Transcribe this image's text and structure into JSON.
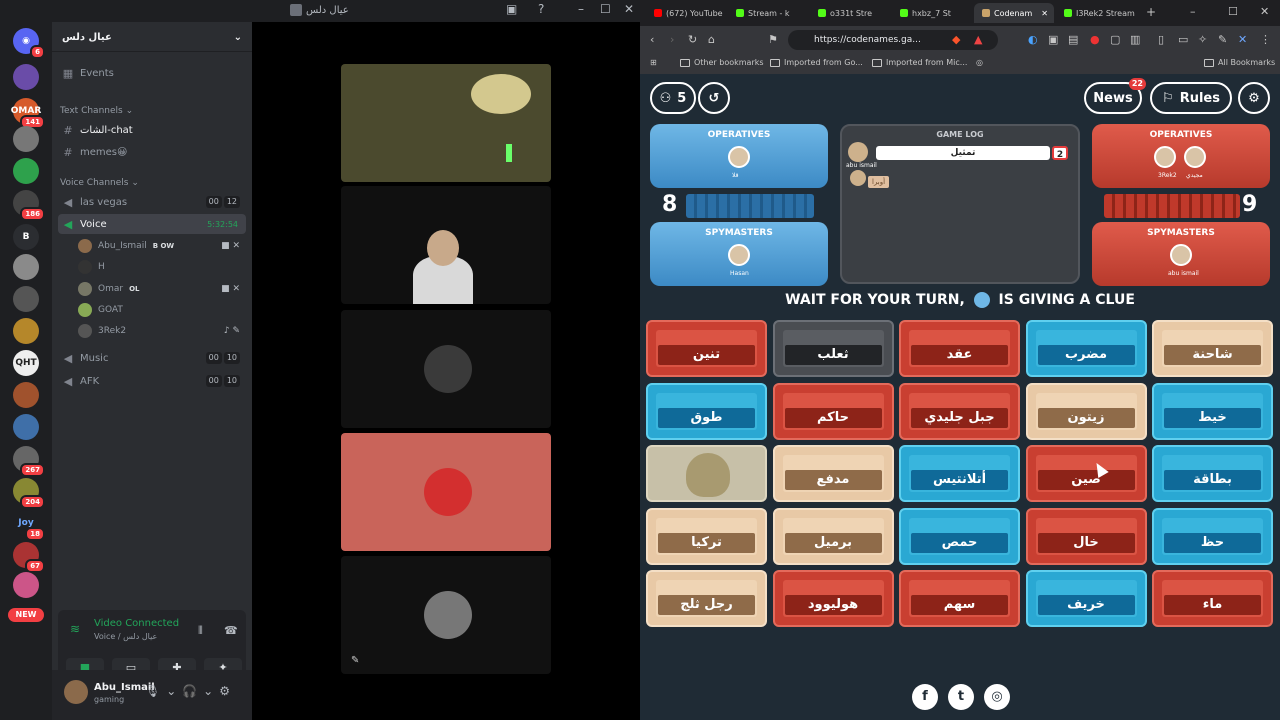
{
  "discord": {
    "window_title": "عيال دلس",
    "server_name": "عيال دلس",
    "events": "Events",
    "text_channels_label": "Text Channels",
    "text_channels": [
      "الشات-chat",
      "memes😀"
    ],
    "voice_channels_label": "Voice Channels",
    "voice_channels": [
      {
        "name": "las vegas",
        "a": "00",
        "b": "12"
      },
      {
        "name": "Voice",
        "timer": "5:32:54"
      },
      {
        "name": "Music",
        "a": "00",
        "b": "10"
      },
      {
        "name": "AFK",
        "a": "00",
        "b": "10"
      }
    ],
    "voice_users": [
      {
        "name": "Abu_Ismail",
        "tag": "B OW"
      },
      {
        "name": "H",
        "tag": ""
      },
      {
        "name": "Omar",
        "tag": "OL"
      },
      {
        "name": "GOAT",
        "tag": ""
      },
      {
        "name": "3Rek2",
        "tag": ""
      }
    ],
    "server_badges": [
      "6",
      "141",
      "186",
      "267",
      "204",
      "18",
      "67"
    ],
    "server_labels": [
      "OMAR",
      "B",
      "QHT",
      "Joy"
    ],
    "new_label": "NEW",
    "vc_status": "Video Connected",
    "vc_sub": "Voice / عيال دلس",
    "user": {
      "name": "Abu_Ismail",
      "status": "gaming"
    }
  },
  "browser": {
    "tabs": [
      "(672) YouTube",
      "Stream - k",
      "o331t Stre",
      "hxbz_7 St",
      "Codenam",
      "I3Rek2 Stream"
    ],
    "url": "https://codenames.ga...",
    "bookmarks": [
      "Other bookmarks",
      "Imported from Go...",
      "Imported from Mic..."
    ],
    "all_bookmarks": "All Bookmarks"
  },
  "game": {
    "players_count": "5",
    "news_label": "News",
    "news_badge": "22",
    "rules_label": "Rules",
    "operatives_label": "OPERATIVES",
    "spymasters_label": "SPYMASTERS",
    "game_log_label": "GAME LOG",
    "blue_score": "8",
    "red_score": "9",
    "blue_spymaster": "Hasan",
    "red_spymaster": "abu ismail",
    "blue_operative": "قلا",
    "red_operatives": [
      "3Rek2",
      "مجيدي"
    ],
    "log_clue": "تمثيل",
    "log_clue_num": "2",
    "log_player": "abu ismail",
    "log_guess": "أوبرا",
    "banner_left": "WAIT FOR YOUR TURN,",
    "banner_right": "IS GIVING A CLUE",
    "cards": [
      {
        "word": "تنين",
        "color": "red"
      },
      {
        "word": "ثعلب",
        "color": "black"
      },
      {
        "word": "عقد",
        "color": "red"
      },
      {
        "word": "مضرب",
        "color": "blue"
      },
      {
        "word": "شاحنة",
        "color": "neutral"
      },
      {
        "word": "طوق",
        "color": "blue"
      },
      {
        "word": "حاكم",
        "color": "red"
      },
      {
        "word": "جبل جليدي",
        "color": "red"
      },
      {
        "word": "زيتون",
        "color": "neutral"
      },
      {
        "word": "خيط",
        "color": "blue"
      },
      {
        "word": "",
        "color": "agent"
      },
      {
        "word": "مدفع",
        "color": "neutral"
      },
      {
        "word": "أتلانتيس",
        "color": "blue"
      },
      {
        "word": "صين",
        "color": "red"
      },
      {
        "word": "بطاقة",
        "color": "blue"
      },
      {
        "word": "تركيا",
        "color": "neutral"
      },
      {
        "word": "برميل",
        "color": "neutral"
      },
      {
        "word": "حمص",
        "color": "blue"
      },
      {
        "word": "خال",
        "color": "red"
      },
      {
        "word": "حظ",
        "color": "blue"
      },
      {
        "word": "رجل ثلج",
        "color": "neutral"
      },
      {
        "word": "هوليوود",
        "color": "red"
      },
      {
        "word": "سهم",
        "color": "red"
      },
      {
        "word": "خريف",
        "color": "blue"
      },
      {
        "word": "ماء",
        "color": "red"
      }
    ],
    "social": [
      "f",
      "t",
      "◎"
    ]
  }
}
